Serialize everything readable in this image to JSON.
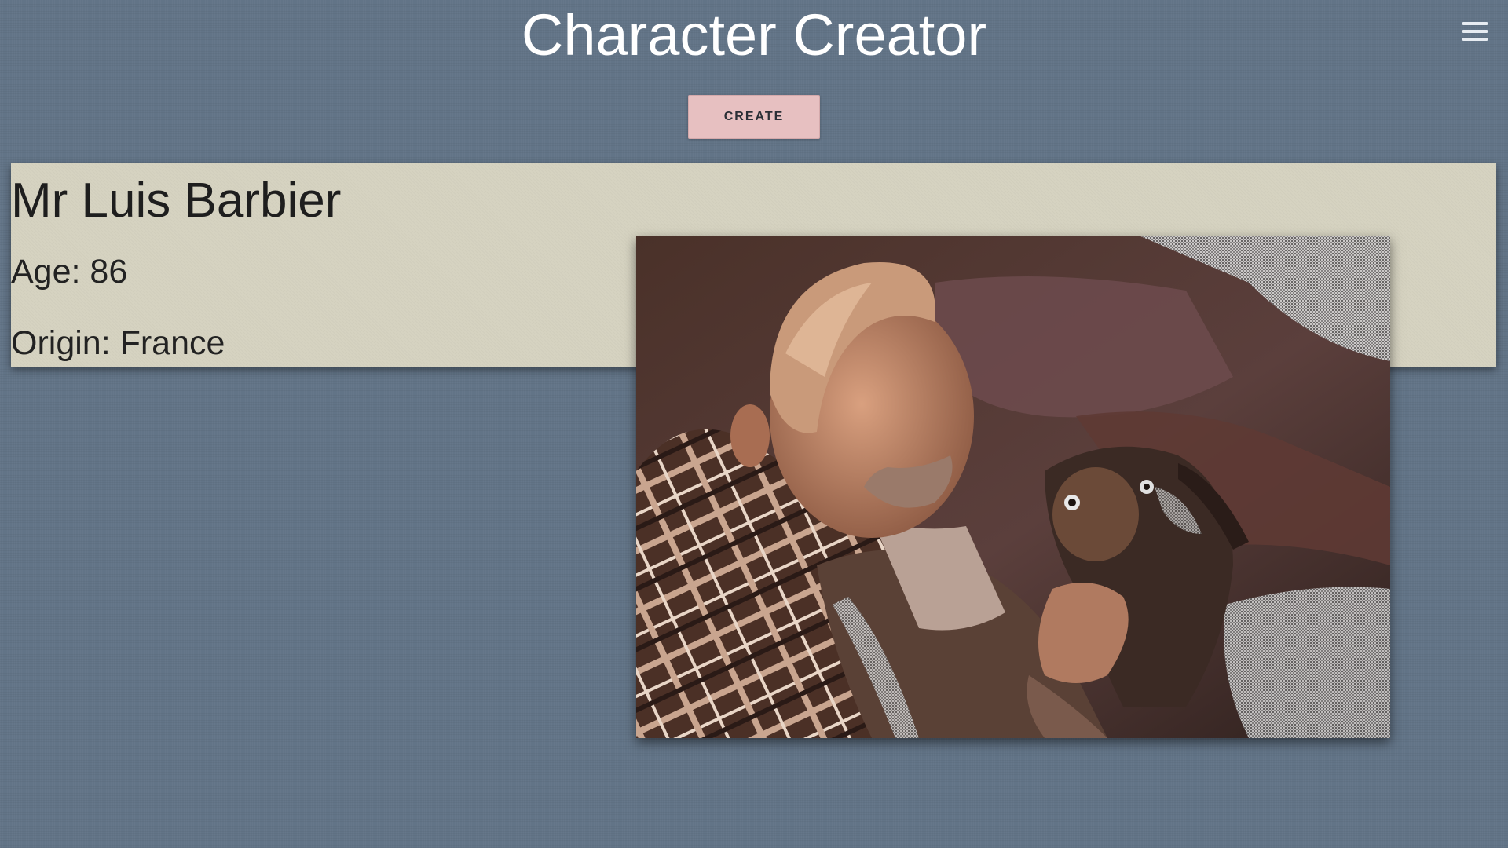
{
  "header": {
    "title": "Character Creator",
    "menu_icon": "hamburger-menu-icon"
  },
  "actions": {
    "create_label": "CREATE"
  },
  "character": {
    "name": "Mr Luis Barbier",
    "age_line": "Age: 86",
    "origin_line": "Origin: France",
    "photo_description_icon": "portrait-photo-elderly-man-with-dog"
  },
  "colors": {
    "background": "#627487",
    "card": "#d6d3c1",
    "button": "#e7c0c1",
    "title_text": "#ffffff"
  }
}
